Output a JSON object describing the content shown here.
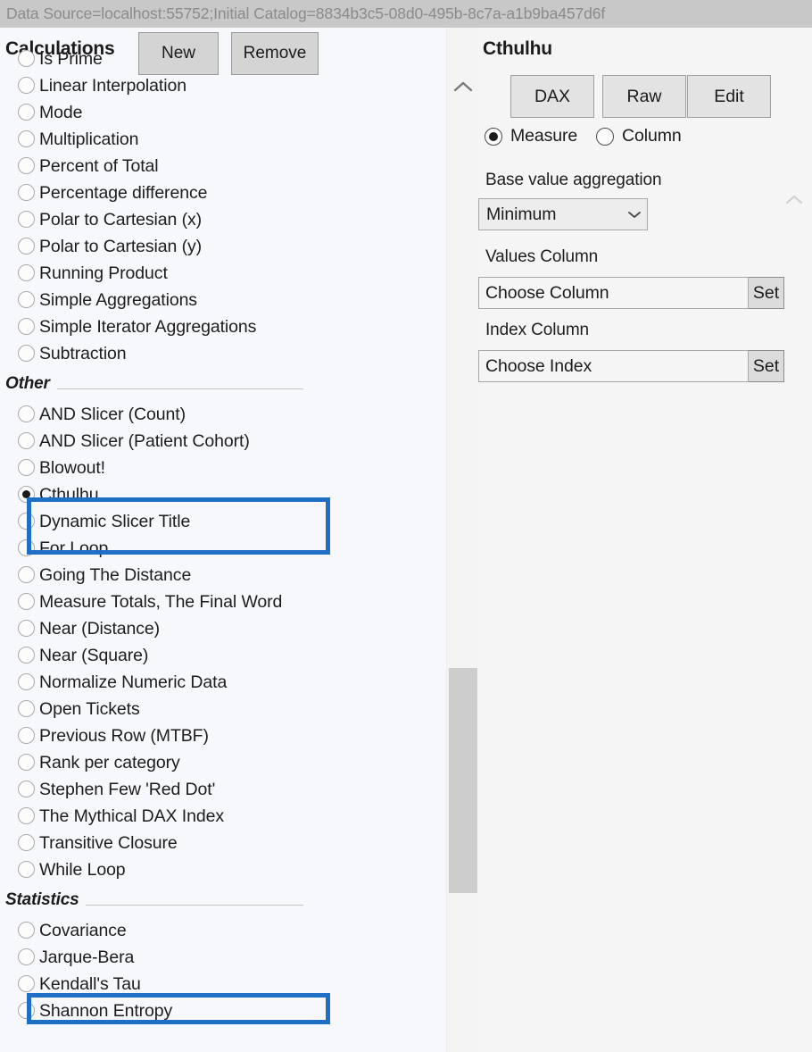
{
  "connection": {
    "text": "Data Source=localhost:55752;Initial Catalog=8834b3c5-08d0-495b-8c7a-a1b9ba457d6f"
  },
  "left_panel": {
    "title": "Calculations",
    "new_button": "New",
    "remove_button": "Remove",
    "scroll_up_icon": "chevron-up-icon",
    "items": [
      {
        "label": "Is Prime",
        "checked": false,
        "partial": true
      },
      {
        "label": "Linear Interpolation",
        "checked": false
      },
      {
        "label": "Mode",
        "checked": false
      },
      {
        "label": "Multiplication",
        "checked": false
      },
      {
        "label": "Percent of Total",
        "checked": false
      },
      {
        "label": "Percentage difference",
        "checked": false
      },
      {
        "label": "Polar to Cartesian (x)",
        "checked": false
      },
      {
        "label": "Polar to Cartesian (y)",
        "checked": false
      },
      {
        "label": "Running Product",
        "checked": false
      },
      {
        "label": "Simple Aggregations",
        "checked": false
      },
      {
        "label": "Simple Iterator Aggregations",
        "checked": false
      },
      {
        "label": "Subtraction",
        "checked": false
      }
    ],
    "sections": [
      {
        "header": "Other",
        "items": [
          {
            "label": "AND Slicer (Count)",
            "checked": false
          },
          {
            "label": "AND Slicer (Patient Cohort)",
            "checked": false
          },
          {
            "label": "Blowout!",
            "checked": false
          },
          {
            "label": "Cthulhu",
            "checked": true
          },
          {
            "label": "Dynamic Slicer Title",
            "checked": false
          },
          {
            "label": "For Loop",
            "checked": false
          },
          {
            "label": "Going The Distance",
            "checked": false
          },
          {
            "label": "Measure Totals, The Final Word",
            "checked": false
          },
          {
            "label": "Near (Distance)",
            "checked": false
          },
          {
            "label": "Near (Square)",
            "checked": false
          },
          {
            "label": "Normalize Numeric Data",
            "checked": false
          },
          {
            "label": "Open Tickets",
            "checked": false
          },
          {
            "label": "Previous Row (MTBF)",
            "checked": false
          },
          {
            "label": "Rank per category",
            "checked": false
          },
          {
            "label": "Stephen Few 'Red Dot'",
            "checked": false
          },
          {
            "label": "The Mythical DAX Index",
            "checked": false
          },
          {
            "label": "Transitive Closure",
            "checked": false
          },
          {
            "label": "While Loop",
            "checked": false
          }
        ]
      },
      {
        "header": "Statistics",
        "items": [
          {
            "label": "Covariance",
            "checked": false
          },
          {
            "label": "Jarque-Bera",
            "checked": false
          },
          {
            "label": "Kendall's Tau",
            "checked": false
          },
          {
            "label": "Shannon Entropy",
            "checked": false
          }
        ]
      }
    ]
  },
  "right_panel": {
    "title": "Cthulhu",
    "buttons": [
      {
        "label": "DAX"
      },
      {
        "label": "Raw"
      },
      {
        "label": "Edit"
      }
    ],
    "kind_options": [
      {
        "label": "Measure",
        "checked": true
      },
      {
        "label": "Column",
        "checked": false
      }
    ],
    "base_value_aggregation_label": "Base value aggregation",
    "base_value_aggregation_value": "Minimum",
    "values_column_label": "Values Column",
    "values_column_value": "Choose Column",
    "values_column_set_button": "Set",
    "index_column_label": "Index Column",
    "index_column_value": "Choose Index",
    "index_column_set_button": "Set",
    "collapse_icon": "chevron-up-icon"
  },
  "colors": {
    "highlight": "#1f6fc4",
    "connbar_bg": "#c8c8c8",
    "panel_bg": "#f5f5f5",
    "list_bg": "#f7f8fc"
  }
}
